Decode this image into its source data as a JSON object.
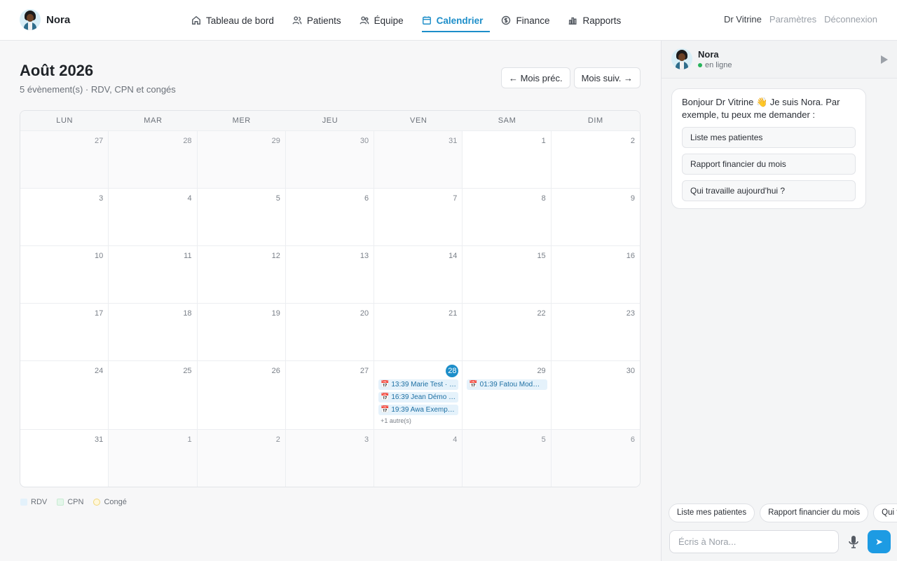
{
  "brand": {
    "name": "Nora"
  },
  "nav": {
    "items": [
      {
        "label": "Tableau de bord",
        "icon": "home-icon",
        "active": false
      },
      {
        "label": "Patients",
        "icon": "users-icon",
        "active": false
      },
      {
        "label": "Équipe",
        "icon": "team-icon",
        "active": false
      },
      {
        "label": "Calendrier",
        "icon": "calendar-icon",
        "active": true
      },
      {
        "label": "Finance",
        "icon": "dollar-icon",
        "active": false
      },
      {
        "label": "Rapports",
        "icon": "bar-chart-icon",
        "active": false
      }
    ],
    "user": "Dr Vitrine",
    "settings": "Paramètres",
    "logout": "Déconnexion",
    "accent_color": "#1d8ec9"
  },
  "calendar": {
    "title": "Août 2026",
    "subtitle": "5 évènement(s) · RDV, CPN et congés",
    "prev_label": "← Mois préc.",
    "next_label": "Mois suiv. →",
    "weekdays": [
      "LUN",
      "MAR",
      "MER",
      "JEU",
      "VEN",
      "SAM",
      "DIM"
    ],
    "weeks": [
      [
        {
          "n": "27",
          "out": true
        },
        {
          "n": "28",
          "out": true
        },
        {
          "n": "29",
          "out": true
        },
        {
          "n": "30",
          "out": true
        },
        {
          "n": "31",
          "out": true
        },
        {
          "n": "1"
        },
        {
          "n": "2"
        }
      ],
      [
        {
          "n": "3"
        },
        {
          "n": "4"
        },
        {
          "n": "5"
        },
        {
          "n": "6"
        },
        {
          "n": "7"
        },
        {
          "n": "8"
        },
        {
          "n": "9"
        }
      ],
      [
        {
          "n": "10"
        },
        {
          "n": "11"
        },
        {
          "n": "12"
        },
        {
          "n": "13"
        },
        {
          "n": "14"
        },
        {
          "n": "15"
        },
        {
          "n": "16"
        }
      ],
      [
        {
          "n": "17"
        },
        {
          "n": "18"
        },
        {
          "n": "19"
        },
        {
          "n": "20"
        },
        {
          "n": "21"
        },
        {
          "n": "22"
        },
        {
          "n": "23"
        }
      ],
      [
        {
          "n": "24"
        },
        {
          "n": "25"
        },
        {
          "n": "26"
        },
        {
          "n": "27"
        },
        {
          "n": "28",
          "today": true,
          "events": [
            "13:39 Marie Test · …",
            "16:39 Jean Démo …",
            "19:39 Awa Exemp…"
          ],
          "more": "+1 autre(s)"
        },
        {
          "n": "29",
          "events": [
            "01:39 Fatou Mod…"
          ]
        },
        {
          "n": "30"
        }
      ],
      [
        {
          "n": "31"
        },
        {
          "n": "1",
          "out": true
        },
        {
          "n": "2",
          "out": true
        },
        {
          "n": "3",
          "out": true
        },
        {
          "n": "4",
          "out": true
        },
        {
          "n": "5",
          "out": true
        },
        {
          "n": "6",
          "out": true
        }
      ]
    ],
    "legend": [
      {
        "label": "RDV",
        "kind": "rdv"
      },
      {
        "label": "CPN",
        "kind": "cpn"
      },
      {
        "label": "Congé",
        "kind": "conge"
      }
    ]
  },
  "chat": {
    "name": "Nora",
    "status": "en ligne",
    "greeting": "Bonjour Dr Vitrine 👋 Je suis Nora. Par exemple, tu peux me demander :",
    "suggestions": [
      "Liste mes patientes",
      "Rapport financier du mois",
      "Qui travaille aujourd'hui ?"
    ],
    "chips": [
      "Liste mes patientes",
      "Rapport financier du mois",
      "Qui travaille aujourd'hui ?"
    ],
    "input_placeholder": "Écris à Nora...",
    "send_label": "➤"
  }
}
